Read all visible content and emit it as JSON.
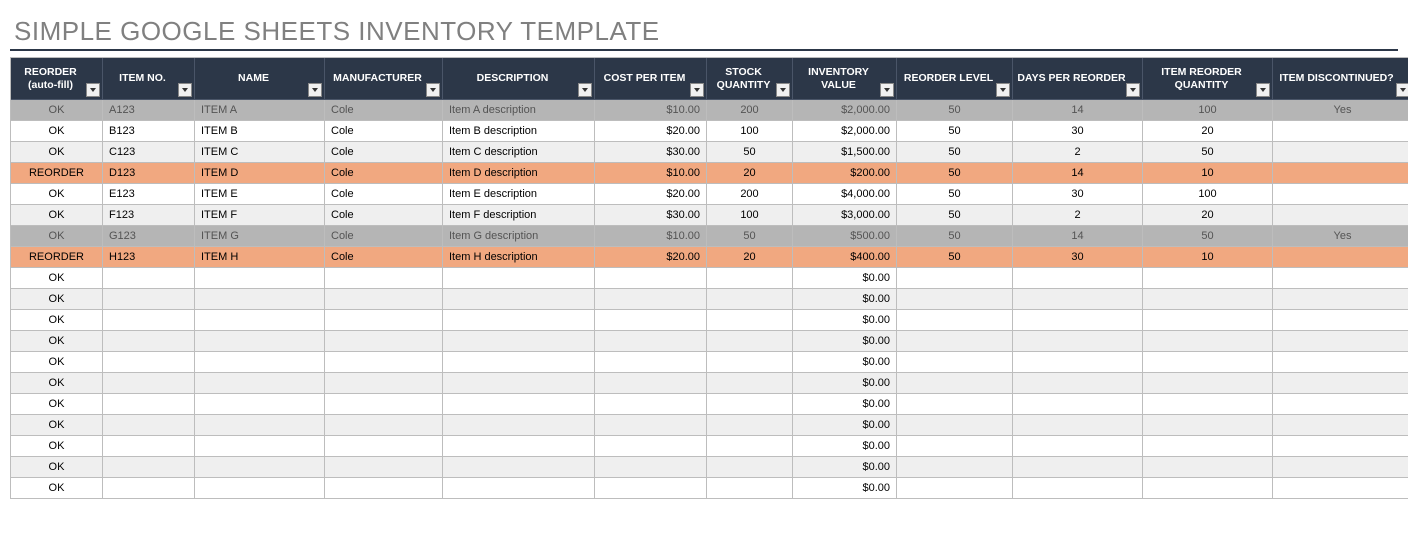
{
  "title": "SIMPLE GOOGLE SHEETS INVENTORY TEMPLATE",
  "columns": [
    {
      "label": "REORDER (auto-fill)",
      "align": "center"
    },
    {
      "label": "ITEM NO.",
      "align": "left"
    },
    {
      "label": "NAME",
      "align": "left"
    },
    {
      "label": "MANUFACTURER",
      "align": "left"
    },
    {
      "label": "DESCRIPTION",
      "align": "left"
    },
    {
      "label": "COST PER ITEM",
      "align": "right"
    },
    {
      "label": "STOCK QUANTITY",
      "align": "center"
    },
    {
      "label": "INVENTORY VALUE",
      "align": "right"
    },
    {
      "label": "REORDER LEVEL",
      "align": "center"
    },
    {
      "label": "DAYS PER REORDER",
      "align": "center"
    },
    {
      "label": "ITEM REORDER QUANTITY",
      "align": "center"
    },
    {
      "label": "ITEM DISCONTINUED?",
      "align": "center"
    }
  ],
  "rows": [
    {
      "status": "OK",
      "item_no": "A123",
      "name": "ITEM A",
      "manufacturer": "Cole",
      "description": "Item A description",
      "cost": "$10.00",
      "stock": "200",
      "inv_value": "$2,000.00",
      "reorder_level": "50",
      "days_per_reorder": "14",
      "reorder_qty": "100",
      "discontinued": "Yes",
      "style": "discontinued"
    },
    {
      "status": "OK",
      "item_no": "B123",
      "name": "ITEM B",
      "manufacturer": "Cole",
      "description": "Item B description",
      "cost": "$20.00",
      "stock": "100",
      "inv_value": "$2,000.00",
      "reorder_level": "50",
      "days_per_reorder": "30",
      "reorder_qty": "20",
      "discontinued": "",
      "style": "alt0"
    },
    {
      "status": "OK",
      "item_no": "C123",
      "name": "ITEM C",
      "manufacturer": "Cole",
      "description": "Item C description",
      "cost": "$30.00",
      "stock": "50",
      "inv_value": "$1,500.00",
      "reorder_level": "50",
      "days_per_reorder": "2",
      "reorder_qty": "50",
      "discontinued": "",
      "style": "alt1"
    },
    {
      "status": "REORDER",
      "item_no": "D123",
      "name": "ITEM D",
      "manufacturer": "Cole",
      "description": "Item D description",
      "cost": "$10.00",
      "stock": "20",
      "inv_value": "$200.00",
      "reorder_level": "50",
      "days_per_reorder": "14",
      "reorder_qty": "10",
      "discontinued": "",
      "style": "reorder"
    },
    {
      "status": "OK",
      "item_no": "E123",
      "name": "ITEM E",
      "manufacturer": "Cole",
      "description": "Item E description",
      "cost": "$20.00",
      "stock": "200",
      "inv_value": "$4,000.00",
      "reorder_level": "50",
      "days_per_reorder": "30",
      "reorder_qty": "100",
      "discontinued": "",
      "style": "alt0"
    },
    {
      "status": "OK",
      "item_no": "F123",
      "name": "ITEM F",
      "manufacturer": "Cole",
      "description": "Item F description",
      "cost": "$30.00",
      "stock": "100",
      "inv_value": "$3,000.00",
      "reorder_level": "50",
      "days_per_reorder": "2",
      "reorder_qty": "20",
      "discontinued": "",
      "style": "alt1"
    },
    {
      "status": "OK",
      "item_no": "G123",
      "name": "ITEM G",
      "manufacturer": "Cole",
      "description": "Item G description",
      "cost": "$10.00",
      "stock": "50",
      "inv_value": "$500.00",
      "reorder_level": "50",
      "days_per_reorder": "14",
      "reorder_qty": "50",
      "discontinued": "Yes",
      "style": "discontinued"
    },
    {
      "status": "REORDER",
      "item_no": "H123",
      "name": "ITEM H",
      "manufacturer": "Cole",
      "description": "Item H description",
      "cost": "$20.00",
      "stock": "20",
      "inv_value": "$400.00",
      "reorder_level": "50",
      "days_per_reorder": "30",
      "reorder_qty": "10",
      "discontinued": "",
      "style": "reorder"
    },
    {
      "status": "OK",
      "item_no": "",
      "name": "",
      "manufacturer": "",
      "description": "",
      "cost": "",
      "stock": "",
      "inv_value": "$0.00",
      "reorder_level": "",
      "days_per_reorder": "",
      "reorder_qty": "",
      "discontinued": "",
      "style": "alt0"
    },
    {
      "status": "OK",
      "item_no": "",
      "name": "",
      "manufacturer": "",
      "description": "",
      "cost": "",
      "stock": "",
      "inv_value": "$0.00",
      "reorder_level": "",
      "days_per_reorder": "",
      "reorder_qty": "",
      "discontinued": "",
      "style": "alt1"
    },
    {
      "status": "OK",
      "item_no": "",
      "name": "",
      "manufacturer": "",
      "description": "",
      "cost": "",
      "stock": "",
      "inv_value": "$0.00",
      "reorder_level": "",
      "days_per_reorder": "",
      "reorder_qty": "",
      "discontinued": "",
      "style": "alt0"
    },
    {
      "status": "OK",
      "item_no": "",
      "name": "",
      "manufacturer": "",
      "description": "",
      "cost": "",
      "stock": "",
      "inv_value": "$0.00",
      "reorder_level": "",
      "days_per_reorder": "",
      "reorder_qty": "",
      "discontinued": "",
      "style": "alt1"
    },
    {
      "status": "OK",
      "item_no": "",
      "name": "",
      "manufacturer": "",
      "description": "",
      "cost": "",
      "stock": "",
      "inv_value": "$0.00",
      "reorder_level": "",
      "days_per_reorder": "",
      "reorder_qty": "",
      "discontinued": "",
      "style": "alt0"
    },
    {
      "status": "OK",
      "item_no": "",
      "name": "",
      "manufacturer": "",
      "description": "",
      "cost": "",
      "stock": "",
      "inv_value": "$0.00",
      "reorder_level": "",
      "days_per_reorder": "",
      "reorder_qty": "",
      "discontinued": "",
      "style": "alt1"
    },
    {
      "status": "OK",
      "item_no": "",
      "name": "",
      "manufacturer": "",
      "description": "",
      "cost": "",
      "stock": "",
      "inv_value": "$0.00",
      "reorder_level": "",
      "days_per_reorder": "",
      "reorder_qty": "",
      "discontinued": "",
      "style": "alt0"
    },
    {
      "status": "OK",
      "item_no": "",
      "name": "",
      "manufacturer": "",
      "description": "",
      "cost": "",
      "stock": "",
      "inv_value": "$0.00",
      "reorder_level": "",
      "days_per_reorder": "",
      "reorder_qty": "",
      "discontinued": "",
      "style": "alt1"
    },
    {
      "status": "OK",
      "item_no": "",
      "name": "",
      "manufacturer": "",
      "description": "",
      "cost": "",
      "stock": "",
      "inv_value": "$0.00",
      "reorder_level": "",
      "days_per_reorder": "",
      "reorder_qty": "",
      "discontinued": "",
      "style": "alt0"
    },
    {
      "status": "OK",
      "item_no": "",
      "name": "",
      "manufacturer": "",
      "description": "",
      "cost": "",
      "stock": "",
      "inv_value": "$0.00",
      "reorder_level": "",
      "days_per_reorder": "",
      "reorder_qty": "",
      "discontinued": "",
      "style": "alt1"
    },
    {
      "status": "OK",
      "item_no": "",
      "name": "",
      "manufacturer": "",
      "description": "",
      "cost": "",
      "stock": "",
      "inv_value": "$0.00",
      "reorder_level": "",
      "days_per_reorder": "",
      "reorder_qty": "",
      "discontinued": "",
      "style": "alt0"
    }
  ],
  "col_field_map": [
    "status",
    "item_no",
    "name",
    "manufacturer",
    "description",
    "cost",
    "stock",
    "inv_value",
    "reorder_level",
    "days_per_reorder",
    "reorder_qty",
    "discontinued"
  ]
}
